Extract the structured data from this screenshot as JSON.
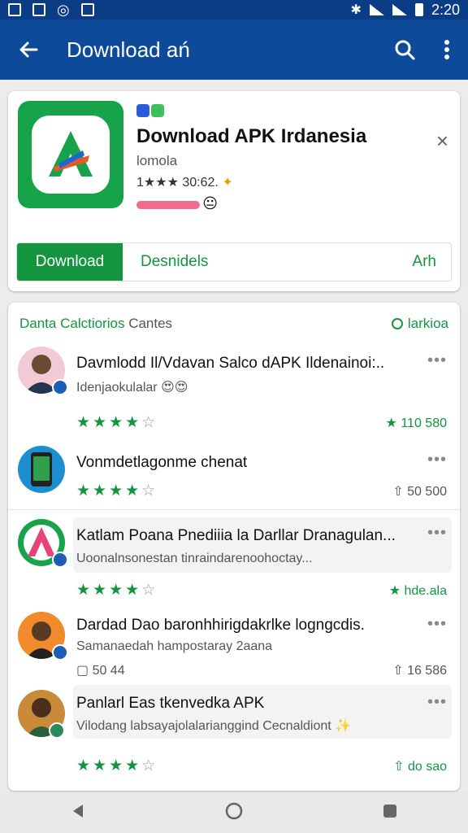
{
  "status_bar": {
    "time": "2:20"
  },
  "app_bar": {
    "title": "Download ań"
  },
  "featured": {
    "name": "Download APK Irdanesia",
    "developer": "lomola",
    "rating_text": "1★★★ 30:62.",
    "progress": 0.5,
    "buttons": {
      "download": "Download",
      "describe": "Desnidels",
      "right": "Arh"
    },
    "brand_color": "#17a34a"
  },
  "list": {
    "title": "Danta Calctiorios",
    "subtitle": "Cantes",
    "right_label": "larkioa",
    "items": [
      {
        "title": "Davmlodd Il/Vdavan Salco dAPK Ildenainoi:..",
        "subtitle": "Idenjaokulalar",
        "count": "110 580",
        "stars": 4
      },
      {
        "title": "Vonmdetlagonme chenat",
        "count": "50 500",
        "stars": 4
      },
      {
        "title": "Katlam Poana Pnediiia la Darllar Dranagulan...",
        "subtitle": "Uoonalnsonestan tinraindarenoohoctay...",
        "count": "hde.ala",
        "stars": 4
      },
      {
        "title": "Dardad Dao baronhhirigdakrlke logngcdis.",
        "subtitle": "Samanaedah hampostaray 2aana",
        "left": "50 44",
        "count": "16 586"
      },
      {
        "title": "Panlarl Eas tkenvedka APK",
        "subtitle": "Vilodang labsayajolalarianggind Cecnaldiont",
        "count": "do sao",
        "stars": 4
      }
    ]
  },
  "colors": {
    "appbar": "#0d4a99",
    "accent": "#13953f"
  }
}
